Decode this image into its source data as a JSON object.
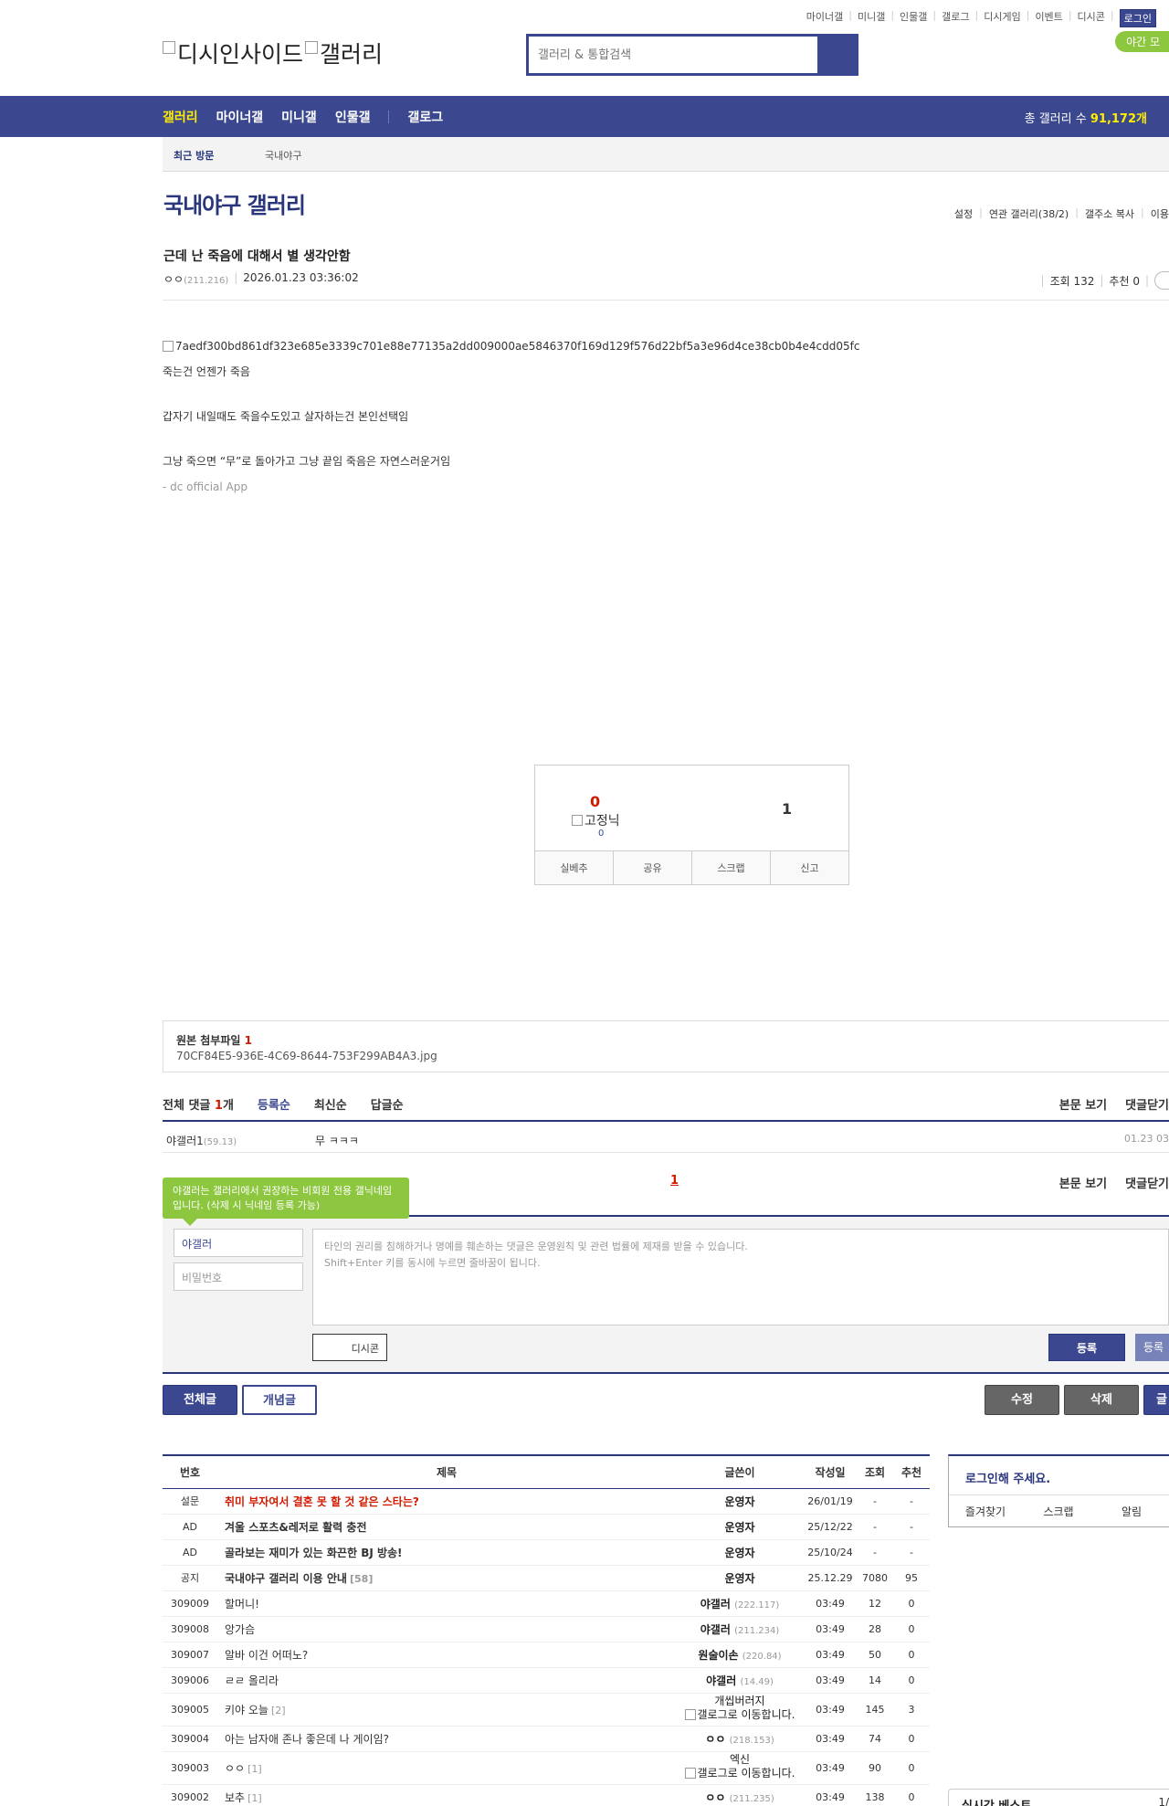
{
  "topmenu": [
    "마이너갤",
    "미니갤",
    "인물갤",
    "갤로그",
    "디시게임",
    "이벤트",
    "디시콘"
  ],
  "login_label": "로그인",
  "night_mode": "야간 모",
  "logo": {
    "part1": "디시인사이드",
    "part2": "갤러리"
  },
  "search": {
    "placeholder": "갤러리 & 통합검색"
  },
  "gnb": {
    "items": [
      "갤러리",
      "마이너갤",
      "미니갤",
      "인물갤",
      "갤로그"
    ],
    "total_label": "총 갤러리 수",
    "total_value": "91,172개"
  },
  "recent": {
    "label": "최근 방문",
    "item": "국내야구"
  },
  "gallery": {
    "title": "국내야구 갤러리",
    "tools": [
      "설정",
      "연관 갤러리(38/2)",
      "갤주소 복사",
      "이용"
    ]
  },
  "post": {
    "title": "근데 난 죽음에 대해서 별 생각안함",
    "author": "ㅇㅇ",
    "ip": "(211.216)",
    "date": "2026.01.23 03:36:02",
    "views": "조회 132",
    "recommend": "추천 0",
    "image_alt": "7aedf300bd861df323e685e3339c701e88e77135a2dd009000ae5846370f169d129f576d22bf5a3e96d4ce38cb0b4e4cdd05fc",
    "lines": [
      "죽는건 언젠가 죽음",
      "갑자기 내일때도 죽을수도있고 살자하는건 본인선택임",
      "그냥 죽으면 “무”로 돌아가고 그냥 끝임 죽음은 자연스러운거임"
    ],
    "signature": "- dc official App"
  },
  "vote": {
    "up": "0",
    "fixed_label": "고정닉",
    "fixed_count": "0",
    "down": "1",
    "buttons": [
      "실베추",
      "공유",
      "스크랩",
      "신고"
    ]
  },
  "attach": {
    "label": "원본 첨부파일",
    "count": "1",
    "filename": "70CF84E5-936E-4C69-8644-753F299AB4A3.jpg"
  },
  "comments": {
    "label": "전체 댓글",
    "count": "1",
    "unit": "개",
    "sort": [
      "등록순",
      "최신순",
      "답글순"
    ],
    "right": [
      "본문 보기",
      "댓글닫기"
    ],
    "items": [
      {
        "name": "야갤러1",
        "ip": "(59.13)",
        "text": "무 ㅋㅋㅋ",
        "date": "01.23 03"
      }
    ],
    "page": "1",
    "tooltip": "야갤러는 갤러리에서 권장하는 비회원 전용 갤닉네임입니다. (삭제 시 닉네임 등록 가능)",
    "nick_value": "야갤러",
    "pw_placeholder": "비밀번호",
    "textarea": "타인의 권리를 침해하거나 명예를 훼손하는 댓글은 운영원칙 및 관련 법률에 제재를 받을 수 있습니다.\nShift+Enter 키를 동시에 누르면 줄바꿈이 됩니다.",
    "dccon": "디시콘",
    "register": "등록",
    "register2": "등록"
  },
  "buttons": {
    "all": "전체글",
    "concept": "개념글",
    "edit": "수정",
    "delete": "삭제",
    "write": "글"
  },
  "table": {
    "headers": [
      "번호",
      "제목",
      "글쓴이",
      "작성일",
      "조회",
      "추천"
    ],
    "rows": [
      {
        "num": "설문",
        "title": "취미 부자여서 결혼 못 할 것 같은 스타는?",
        "style": "red",
        "writer": "운영자",
        "ip": "",
        "date": "26/01/19",
        "views": "-",
        "rec": "-"
      },
      {
        "num": "AD",
        "title": "겨울 스포츠&레저로 활력 충전",
        "style": "bold",
        "writer": "운영자",
        "ip": "",
        "date": "25/12/22",
        "views": "-",
        "rec": "-"
      },
      {
        "num": "AD",
        "title": "골라보는 재미가 있는 화끈한 BJ 방송!",
        "style": "bold",
        "writer": "운영자",
        "ip": "",
        "date": "25/10/24",
        "views": "-",
        "rec": "-"
      },
      {
        "num": "공지",
        "title": "국내야구 갤러리 이용 안내",
        "style": "bold",
        "cm": "[58]",
        "writer": "운영자",
        "ip": "",
        "date": "25.12.29",
        "views": "7080",
        "rec": "95"
      },
      {
        "num": "309009",
        "title": "할머니!",
        "writer": "야갤러",
        "ip": "(222.117)",
        "date": "03:49",
        "views": "12",
        "rec": "0"
      },
      {
        "num": "309008",
        "title": "앙가슴",
        "writer": "야갤러",
        "ip": "(211.234)",
        "date": "03:49",
        "views": "28",
        "rec": "0"
      },
      {
        "num": "309007",
        "title": "알바 이건 어떠노?",
        "writer": "원술이손",
        "ip": "(220.84)",
        "date": "03:49",
        "views": "50",
        "rec": "0"
      },
      {
        "num": "309006",
        "title": "ㄹㄹ 올리라",
        "writer": "야갤러",
        "ip": "(14.49)",
        "date": "03:49",
        "views": "14",
        "rec": "0"
      },
      {
        "num": "309005",
        "title": "키야 오늘",
        "cm": "[2]",
        "writer": "개씹버러지",
        "gallog": "갤로그로 이동합니다.",
        "date": "03:49",
        "views": "145",
        "rec": "3"
      },
      {
        "num": "309004",
        "title": "아는 남자애 존나 좋은데 나 게이임?",
        "writer": "ㅇㅇ",
        "ip": "(218.153)",
        "date": "03:49",
        "views": "74",
        "rec": "0"
      },
      {
        "num": "309003",
        "title": "ㅇㅇ",
        "cm": "[1]",
        "writer": "엑신",
        "gallog": "갤로그로 이동합니다.",
        "date": "03:49",
        "views": "90",
        "rec": "0"
      },
      {
        "num": "309002",
        "title": "보추",
        "cm": "[1]",
        "writer": "ㅇㅇ",
        "ip": "(211.235)",
        "date": "03:49",
        "views": "138",
        "rec": "0"
      }
    ]
  },
  "loginbox": {
    "title": "로그인해 주세요.",
    "items": [
      "즐겨찾기",
      "스크랩",
      "알림"
    ]
  },
  "realtime": {
    "title": "실시간 베스트",
    "page": "1/"
  }
}
